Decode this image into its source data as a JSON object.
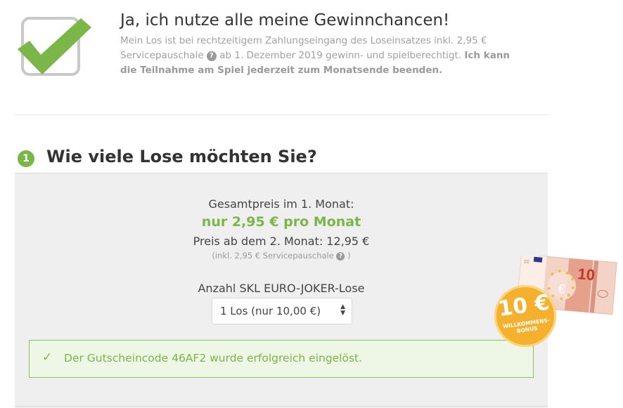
{
  "consent": {
    "title": "Ja, ich nutze alle meine Gewinnchancen!",
    "text_part1": "Mein Los ist bei rechtzeitigem Zahlungseingang des Loseinsatzes inkl. 2,95 € Servicepauschale",
    "help_icon": "?",
    "text_part2": "ab 1. Dezember 2019 gewinn- und spielberechtigt.",
    "text_bold": "Ich kann die Teilnahme am Spiel jederzeit zum Monatsende beenden.",
    "checked": true,
    "check_color": "#7ab648"
  },
  "step": {
    "number": "1",
    "title": "Wie viele Lose möchten Sie?"
  },
  "pricing": {
    "total_label": "Gesamtpreis im 1. Monat:",
    "promo_price": "nur 2,95 € pro Monat",
    "regular_price": "Preis ab dem 2. Monat: 12,95 €",
    "fee_note_open": "(inkl. 2,95 € Servicepauschale",
    "fee_note_close": ")"
  },
  "ticket_select": {
    "label": "Anzahl SKL EURO-JOKER-Lose",
    "value": "1 Los (nur 10,00 €)",
    "arrow_up": "▲",
    "arrow_down": "▼"
  },
  "voucher": {
    "check": "✓",
    "message": "Der Gutscheincode 46AF2 wurde erfolgreich eingelöst."
  },
  "bonus": {
    "amount": "10 €",
    "label": "WILLKOMMENS-BONUS",
    "note_value": "10",
    "note_symbol": "€"
  },
  "colors": {
    "accent_green": "#7ab648",
    "badge_orange": "#f5b12e"
  }
}
